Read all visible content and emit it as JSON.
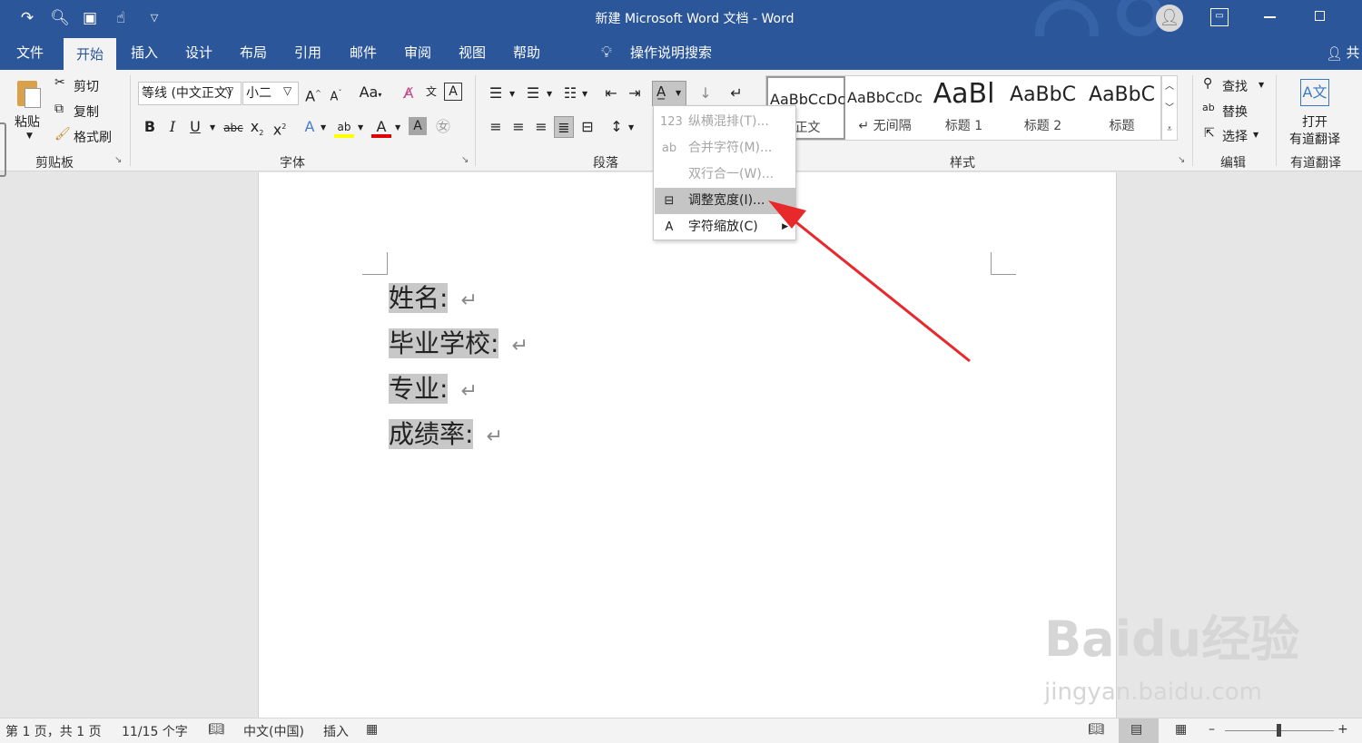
{
  "window": {
    "title": "新建 Microsoft Word 文档  -  Word"
  },
  "quick_access": {
    "icons": [
      "redo-icon",
      "print-preview-icon",
      "save-icon",
      "touch-mode-icon",
      "customize-qat-icon"
    ]
  },
  "tabs": [
    "文件",
    "开始",
    "插入",
    "设计",
    "布局",
    "引用",
    "邮件",
    "审阅",
    "视图",
    "帮助"
  ],
  "active_tab": "开始",
  "tell_me": "操作说明搜索",
  "share_label": "共",
  "ribbon": {
    "clipboard": {
      "paste": "粘贴",
      "cut": "剪切",
      "copy": "复制",
      "format_painter": "格式刷",
      "label": "剪贴板"
    },
    "font": {
      "font_name": "等线 (中文正文)",
      "font_size": "小二",
      "label": "字体"
    },
    "paragraph": {
      "label": "段落"
    },
    "styles": {
      "label": "样式",
      "items": [
        {
          "preview": "AaBbCcDc",
          "name": "正文"
        },
        {
          "preview": "AaBbCcDc",
          "name": "↵ 无间隔"
        },
        {
          "preview": "AaBl",
          "name": "标题 1"
        },
        {
          "preview": "AaBbC",
          "name": "标题 2"
        },
        {
          "preview": "AaBbC",
          "name": "标题"
        }
      ]
    },
    "editing": {
      "find": "查找",
      "replace": "替换",
      "select": "选择",
      "label": "编辑"
    },
    "youdao": {
      "open": "打开",
      "name": "有道翻译",
      "label": "有道翻译"
    }
  },
  "dropdown": {
    "items": [
      {
        "icon": "vertical-in-horizontal-icon",
        "label": "纵横混排(T)...",
        "disabled": true
      },
      {
        "icon": "combine-characters-icon",
        "label": "合并字符(M)...",
        "disabled": true
      },
      {
        "icon": "two-lines-in-one-icon",
        "label": "双行合一(W)...",
        "disabled": true
      },
      {
        "icon": "fit-text-icon",
        "label": "调整宽度(I)...",
        "disabled": false,
        "highlighted": true
      },
      {
        "icon": "character-scale-icon",
        "label": "字符缩放(C)",
        "disabled": false,
        "submenu": true
      }
    ]
  },
  "document": {
    "lines": [
      "姓名:",
      "毕业学校:",
      "专业:",
      "成绩率:"
    ]
  },
  "status": {
    "page": "第 1 页，共 1 页",
    "words": "11/15 个字",
    "language": "中文(中国)",
    "mode": "插入"
  },
  "watermark": {
    "text": "Baidu经验",
    "url": "jingyan.baidu.com"
  }
}
